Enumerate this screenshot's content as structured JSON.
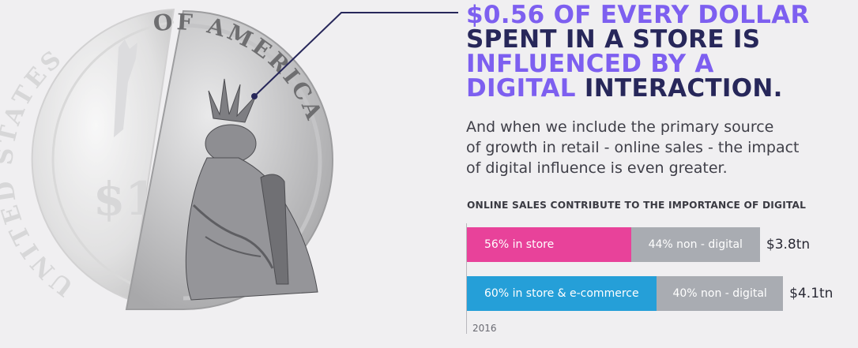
{
  "headline": {
    "line1": "$0.56 OF EVERY DOLLAR",
    "line2": "SPENT IN A STORE IS",
    "line3": "INFLUENCED BY A",
    "line4_highlight": "DIGITAL",
    "line4_dark": " INTERACTION."
  },
  "subtext": {
    "line1": "And when we include the primary source",
    "line2": "of growth in retail - online sales - the impact",
    "line3": "of digital influence is even greater."
  },
  "coin": {
    "left_text": "UNITED STATES",
    "right_text": "OF AMERICA",
    "denomination": "$1"
  },
  "colors": {
    "highlight": "#7d5ff0",
    "dark": "#27275a",
    "in_store": "#e8429a",
    "in_store_ecommerce": "#259fd8",
    "non_digital": "#a9acb2"
  },
  "chart_data": {
    "type": "bar",
    "orientation": "horizontal",
    "stacked": true,
    "title": "ONLINE SALES CONTRIBUTE TO THE IMPORTANCE OF DIGITAL",
    "xlabel": "2016",
    "categories": [
      "56% in store",
      "60% in store & e-commerce"
    ],
    "rows": [
      {
        "total_label": "$3.8tn",
        "total": 3.8,
        "segments": [
          {
            "label": "56% in store",
            "value": 56,
            "color": "#e8429a"
          },
          {
            "label": "44% non - digital",
            "value": 44,
            "color": "#a9acb2"
          }
        ]
      },
      {
        "total_label": "$4.1tn",
        "total": 4.1,
        "segments": [
          {
            "label": "60% in store & e-commerce",
            "value": 60,
            "color": "#259fd8"
          },
          {
            "label": "40% non - digital",
            "value": 40,
            "color": "#a9acb2"
          }
        ]
      }
    ]
  }
}
